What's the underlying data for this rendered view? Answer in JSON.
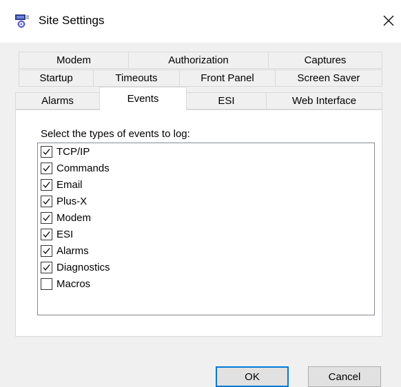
{
  "window": {
    "title": "Site Settings"
  },
  "tabs": {
    "row1": [
      "Modem",
      "Authorization",
      "Captures"
    ],
    "row2": [
      "Startup",
      "Timeouts",
      "Front Panel",
      "Screen Saver"
    ],
    "row3": [
      "Alarms",
      "Events",
      "ESI",
      "Web Interface"
    ],
    "active": "Events"
  },
  "events_panel": {
    "prompt": "Select the types of events to log:",
    "items": [
      {
        "label": "TCP/IP",
        "checked": true
      },
      {
        "label": "Commands",
        "checked": true
      },
      {
        "label": "Email",
        "checked": true
      },
      {
        "label": "Plus-X",
        "checked": true
      },
      {
        "label": "Modem",
        "checked": true
      },
      {
        "label": "ESI",
        "checked": true
      },
      {
        "label": "Alarms",
        "checked": true
      },
      {
        "label": "Diagnostics",
        "checked": true
      },
      {
        "label": "Macros",
        "checked": false
      }
    ]
  },
  "buttons": {
    "ok": "OK",
    "cancel": "Cancel"
  },
  "colors": {
    "accent_border": "#0078d7",
    "panel_border": "#d9d9d9"
  },
  "icons": {
    "app": "settings-app-icon",
    "close": "close-icon",
    "check": "check-icon"
  }
}
